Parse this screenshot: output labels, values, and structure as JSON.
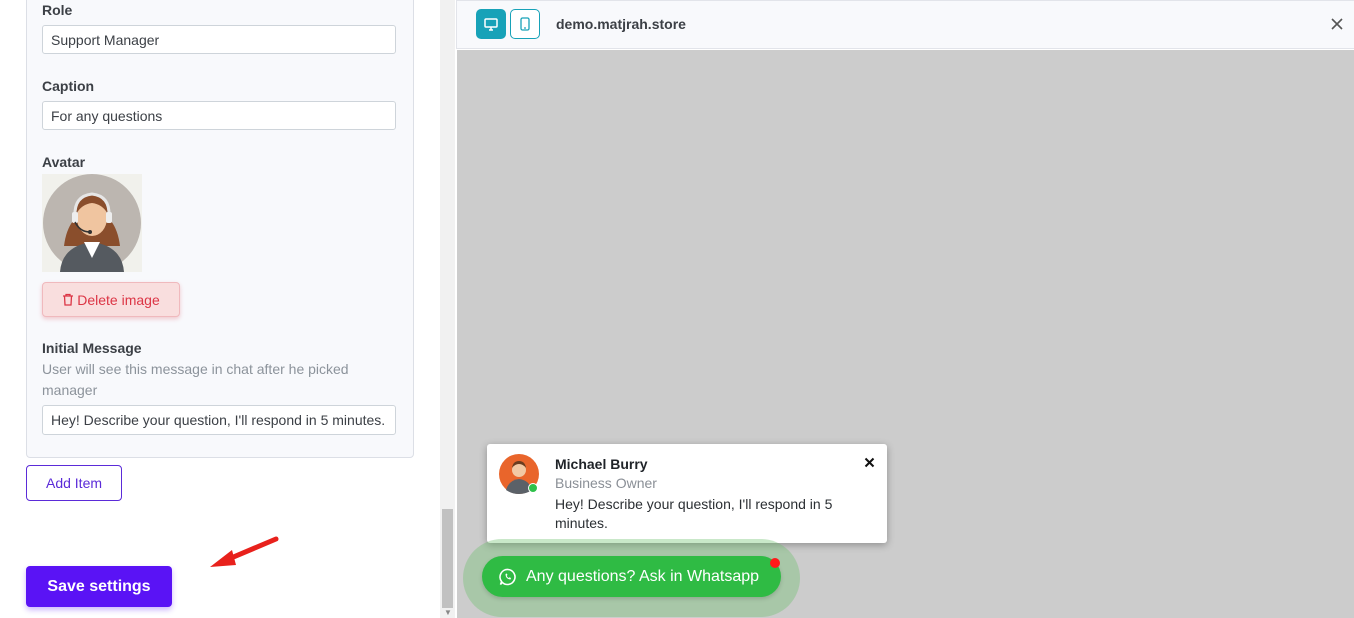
{
  "form": {
    "role_label": "Role",
    "role_value": "Support Manager",
    "caption_label": "Caption",
    "caption_value": "For any questions",
    "avatar_label": "Avatar",
    "delete_image_label": "Delete image",
    "initial_message_label": "Initial Message",
    "initial_message_help": "User will see this message in chat after he picked manager",
    "initial_message_value": "Hey! Describe your question, I'll respond in 5 minutes.",
    "add_item_label": "Add Item",
    "save_label": "Save settings"
  },
  "preview": {
    "domain": "demo.matjrah.store",
    "agent_name": "Michael Burry",
    "agent_role": "Business Owner",
    "agent_message": "Hey! Describe your question, I'll respond in 5 minutes.",
    "whatsapp_button_label": "Any questions? Ask in Whatsapp"
  },
  "colors": {
    "primary": "#5a13f5",
    "accent_teal": "#17a2b8",
    "danger": "#dc3545",
    "whatsapp_green": "#2fbb44",
    "preview_bg": "#cccccc"
  },
  "icons": {
    "desktop": "desktop-icon",
    "mobile": "mobile-icon",
    "close": "close-icon",
    "trash": "trash-icon",
    "whatsapp": "whatsapp-icon",
    "arrow": "red-arrow-annotation"
  }
}
